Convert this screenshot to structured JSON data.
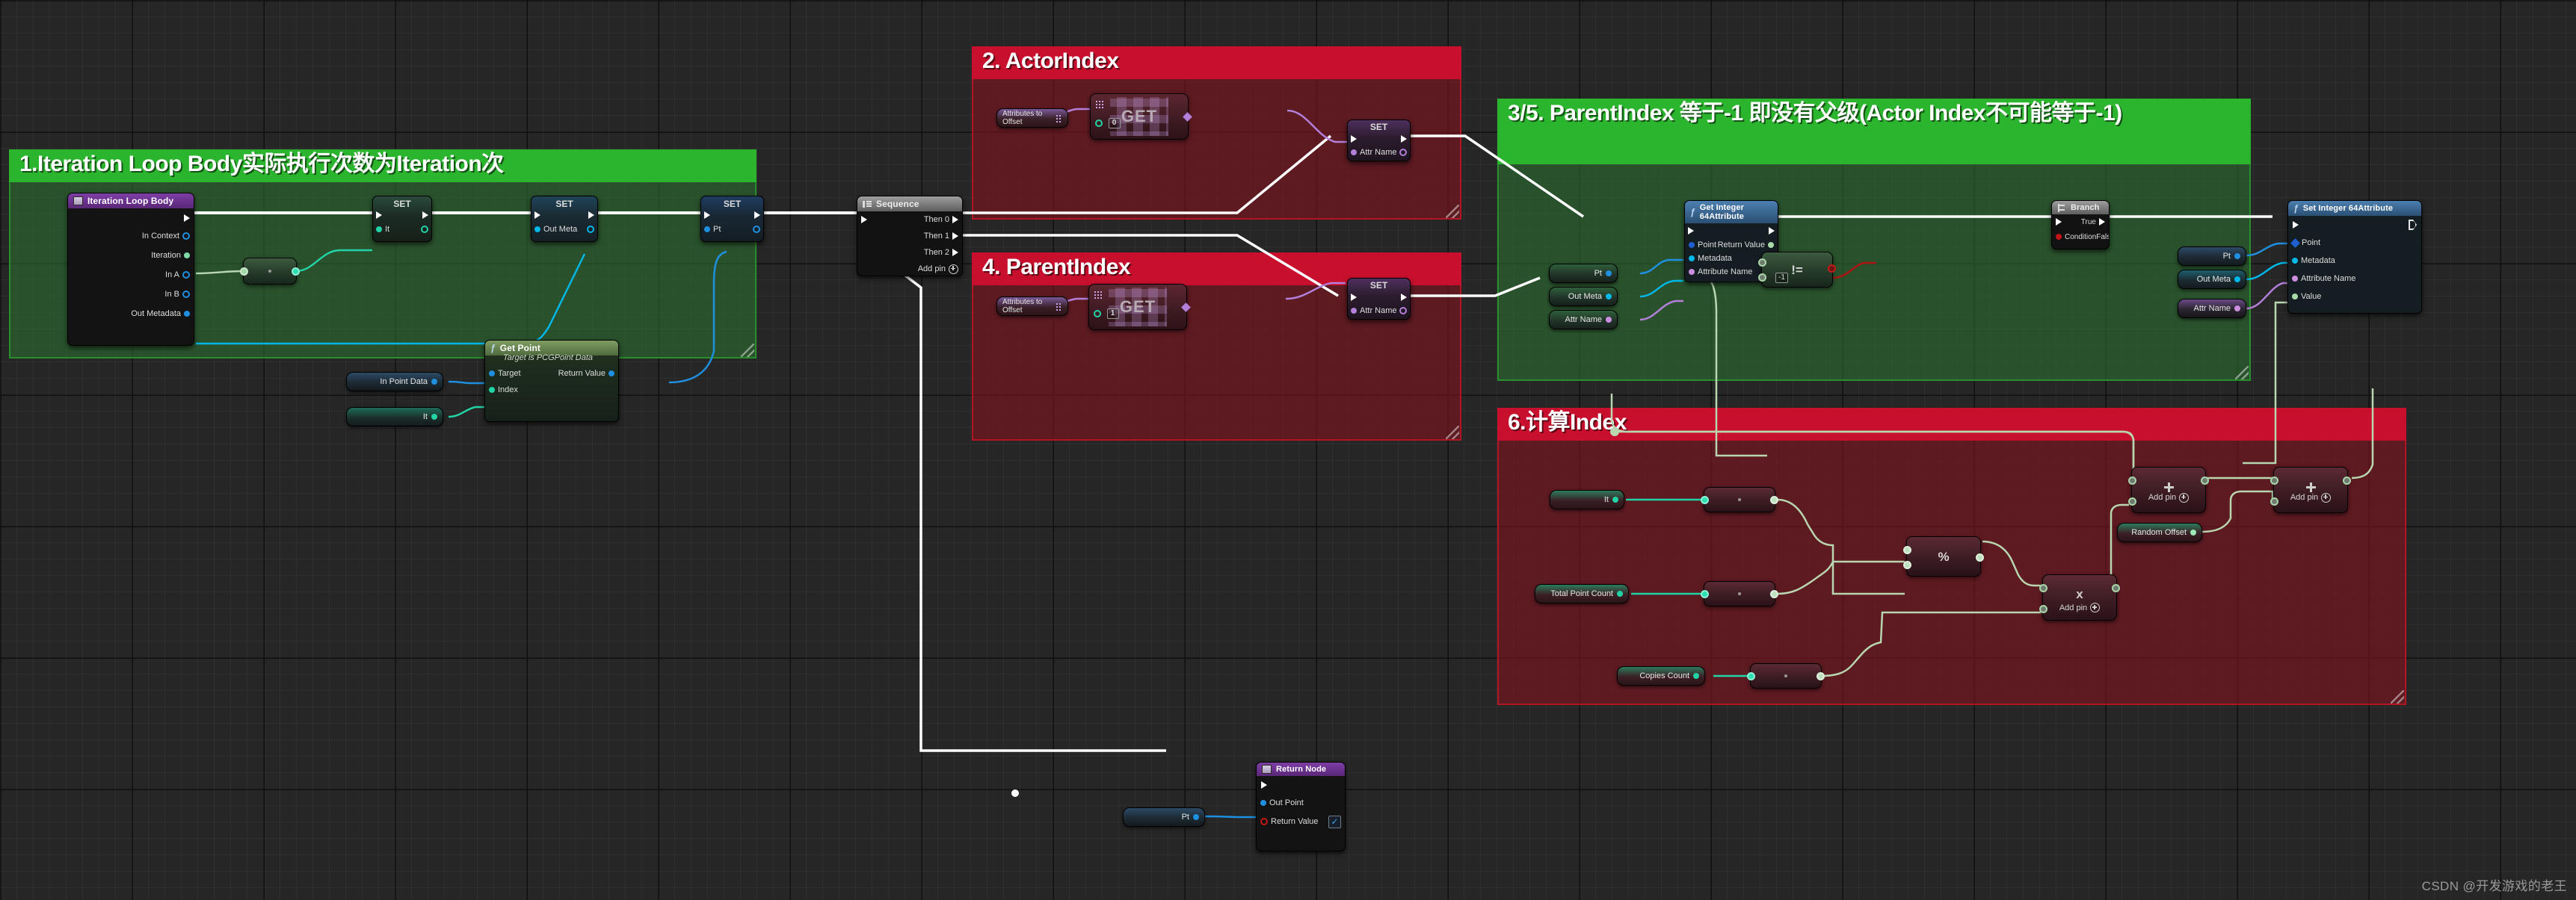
{
  "app": {
    "watermark": "CSDN @开发游戏的老王"
  },
  "comments": [
    {
      "id": "c1",
      "title": "1.Iteration Loop Body实际执行次数为Iteration次",
      "color": "#2bb42e",
      "kind": "green"
    },
    {
      "id": "c2",
      "title": "2. ActorIndex",
      "color": "#c8102e",
      "kind": "red"
    },
    {
      "id": "c4",
      "title": "4. ParentIndex",
      "color": "#c8102e",
      "kind": "red"
    },
    {
      "id": "c35",
      "title": "3/5. ParentIndex 等于-1 即没有父级(Actor Index不可能等于-1)",
      "color": "#2bb42e",
      "kind": "green"
    },
    {
      "id": "c6",
      "title": "6.计算Index",
      "color": "#c8102e",
      "kind": "red"
    }
  ],
  "nodes": {
    "iteration_loop_body": {
      "title": "Iteration Loop Body",
      "pins": [
        "In Context",
        "Iteration",
        "In A",
        "In B",
        "Out Metadata"
      ]
    },
    "set_it": {
      "title": "SET",
      "pin": "It"
    },
    "set_outmeta": {
      "title": "SET",
      "pin": "Out Meta"
    },
    "set_pt": {
      "title": "SET",
      "pin": "Pt"
    },
    "get_point": {
      "title": "Get Point",
      "subtitle": "Target is PCGPoint Data",
      "in_pins": [
        "Target",
        "Index"
      ],
      "out_pins": [
        "Return Value"
      ]
    },
    "var_in_point_data": {
      "label": "In Point Data"
    },
    "var_it_getpoint": {
      "label": "It"
    },
    "sequence": {
      "title": "Sequence",
      "outputs": [
        "Then 0",
        "Then 1",
        "Then 2"
      ],
      "add_pin": "Add pin"
    },
    "actorindex_attrs": {
      "label": "Attributes to Offset"
    },
    "actorindex_get": {
      "label": "GET",
      "index": "0"
    },
    "actorindex_set": {
      "title": "SET",
      "pin": "Attr Name"
    },
    "parentindex_attrs": {
      "label": "Attributes to Offset"
    },
    "parentindex_get": {
      "label": "GET",
      "index": "1"
    },
    "parentindex_set": {
      "title": "SET",
      "pin": "Attr Name"
    },
    "get_int64_attr": {
      "title": "Get Integer 64Attribute",
      "in_pins": [
        "Point",
        "Metadata",
        "Attribute Name"
      ],
      "out_pins": [
        "Return Value"
      ]
    },
    "var_pt_a": {
      "label": "Pt"
    },
    "var_outmeta_a": {
      "label": "Out Meta"
    },
    "var_attrname_a": {
      "label": "Attr Name"
    },
    "notequal": {
      "symbol": "!=",
      "literal": "-1"
    },
    "branch": {
      "title": "Branch",
      "condition": "Condition",
      "true": "True",
      "false": "False"
    },
    "set_int64_attr": {
      "title": "Set Integer 64Attribute",
      "in_pins": [
        "Point",
        "Metadata",
        "Attribute Name",
        "Value"
      ]
    },
    "var_pt_b": {
      "label": "Pt"
    },
    "var_outmeta_b": {
      "label": "Out Meta"
    },
    "var_attrname_b": {
      "label": "Attr Name"
    },
    "var_it_calc": {
      "label": "It"
    },
    "var_total_point_count": {
      "label": "Total Point Count"
    },
    "var_copies_count": {
      "label": "Copies Count"
    },
    "var_random_offset": {
      "label": "Random Offset"
    },
    "mod": {
      "symbol": "%"
    },
    "mul": {
      "symbol": "x",
      "add_pin": "Add pin"
    },
    "add1": {
      "symbol": "+",
      "add_pin": "Add pin"
    },
    "add2": {
      "symbol": "+",
      "add_pin": "Add pin"
    },
    "return_node": {
      "title": "Return Node",
      "pins": [
        "Out Point",
        "Return Value"
      ],
      "return_value_checked": "✓"
    },
    "var_pt_return": {
      "label": "Pt"
    }
  },
  "colors": {
    "exec_white": "#ffffff",
    "wire_blue": "#1f8fe0",
    "wire_cyan": "#00b7e8",
    "wire_purple": "#b37fd9",
    "wire_green": "#b9d6b0",
    "wire_teal": "#22d3a5",
    "wire_red": "#b01313",
    "comment_green": "#2bb42e",
    "comment_red": "#c8102e"
  }
}
